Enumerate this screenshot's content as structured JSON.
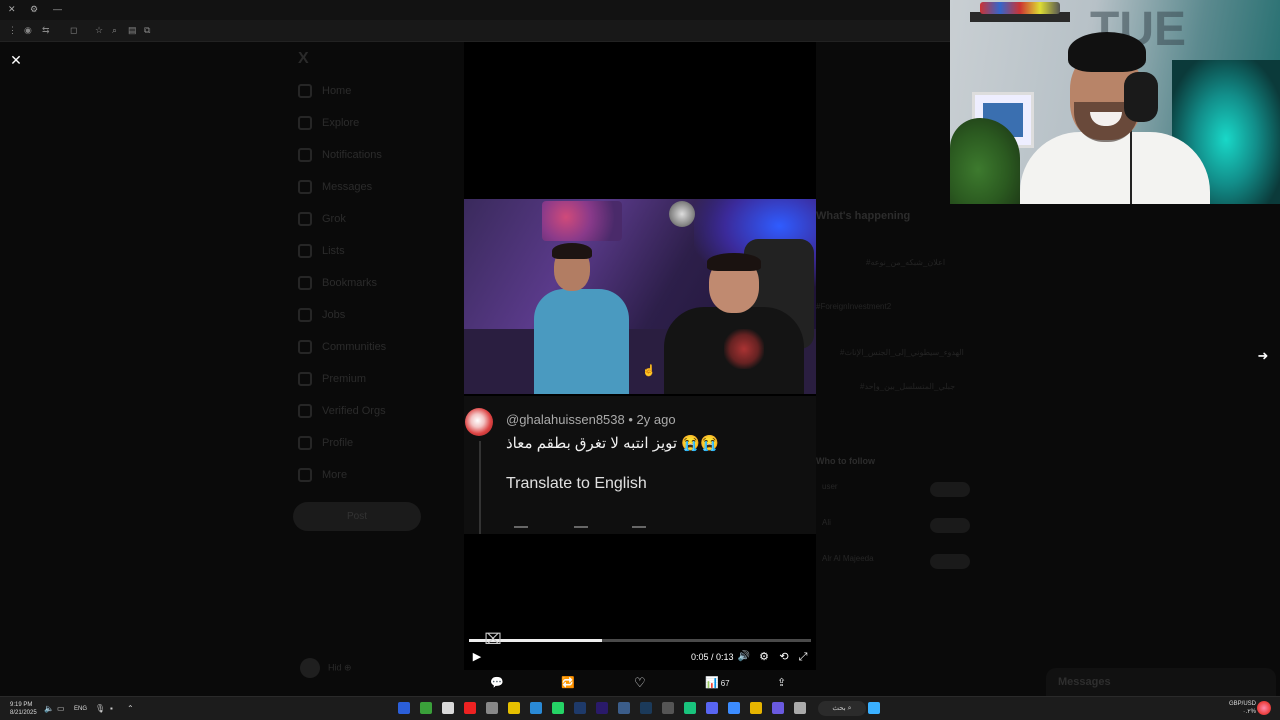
{
  "browser": {
    "close_glyph": "✕",
    "settings_glyph": "⚙",
    "minimize_glyph": "—"
  },
  "x_background": {
    "logo": "X",
    "nav_items": [
      "Home",
      "Explore",
      "Notifications",
      "Messages",
      "Grok",
      "Lists",
      "Bookmarks",
      "Jobs",
      "Communities",
      "Premium",
      "Verified Orgs",
      "Profile",
      "More"
    ],
    "post_label": "Post",
    "profile_name": "Hid ⊕",
    "right_header": "What's happening",
    "trends": [
      "#اعلان_شبكه_من_نوعه",
      "#ForeignInvestment2",
      "#الهدوء_سيطوني_إلى_الجنس_الإناث",
      "#جبلي_المتسلسل_بين_وإحد"
    ],
    "who_to_follow": "Who to follow",
    "follow_rows": [
      "user",
      "Ali",
      "Alr Al Majeeda"
    ],
    "messages_label": "Messages"
  },
  "viewer": {
    "close_glyph": "✕",
    "next_glyph": "➜"
  },
  "comment": {
    "handle": "@ghalahuissen8538",
    "age": "2y ago",
    "text": "تويز انتبه لا تغرق بطقم معاذ 😭😭",
    "translate_label": "Translate to English"
  },
  "player": {
    "progress": 0.39,
    "timecode": "0:05 / 0:13",
    "play_glyph": "▶",
    "volume_glyph": "🔊",
    "settings_glyph": "⚙",
    "loop_glyph": "⟲",
    "fullscreen_glyph": "⤢"
  },
  "post_actions": {
    "reply_glyph": "💬",
    "repost_glyph": "🔁",
    "like_glyph": "♡",
    "views_glyph": "📊",
    "views_count": "67",
    "share_glyph": "⇪"
  },
  "webcam": {
    "logo_text": "TUE"
  },
  "taskbar": {
    "time": "9:19 PM",
    "date": "8/21/2025",
    "language": "ENG",
    "search_label": "بحث",
    "fx_pair": "GBP/USD",
    "fx_change": "۰.۲%",
    "apps": [
      {
        "name": "word-icon",
        "color": "#2b5fd9"
      },
      {
        "name": "xbox-icon",
        "color": "#3aa03a"
      },
      {
        "name": "calendar-icon",
        "color": "#d9d9d9"
      },
      {
        "name": "youtube-icon",
        "color": "#e22"
      },
      {
        "name": "mic-app-icon",
        "color": "#888"
      },
      {
        "name": "notes-icon",
        "color": "#e6c000"
      },
      {
        "name": "photos-icon",
        "color": "#2a8ad6"
      },
      {
        "name": "whatsapp-icon",
        "color": "#25d366"
      },
      {
        "name": "photoshop-icon",
        "color": "#1e3a6a"
      },
      {
        "name": "premiere-icon",
        "color": "#2a1a6a"
      },
      {
        "name": "mail-icon",
        "color": "#3b5d8a"
      },
      {
        "name": "steam-icon",
        "color": "#1b3a5a"
      },
      {
        "name": "settings-icon",
        "color": "#555"
      },
      {
        "name": "capcut-icon",
        "color": "#19c37d"
      },
      {
        "name": "discord-icon",
        "color": "#5865f2"
      },
      {
        "name": "chrome-icon",
        "color": "#3c8cff"
      },
      {
        "name": "explorer-icon",
        "color": "#e6b400"
      },
      {
        "name": "copilot-icon",
        "color": "#6a5adf"
      },
      {
        "name": "taskview-icon",
        "color": "#aaa"
      },
      {
        "name": "windows-start-icon",
        "color": "#3ab0ff"
      }
    ]
  }
}
